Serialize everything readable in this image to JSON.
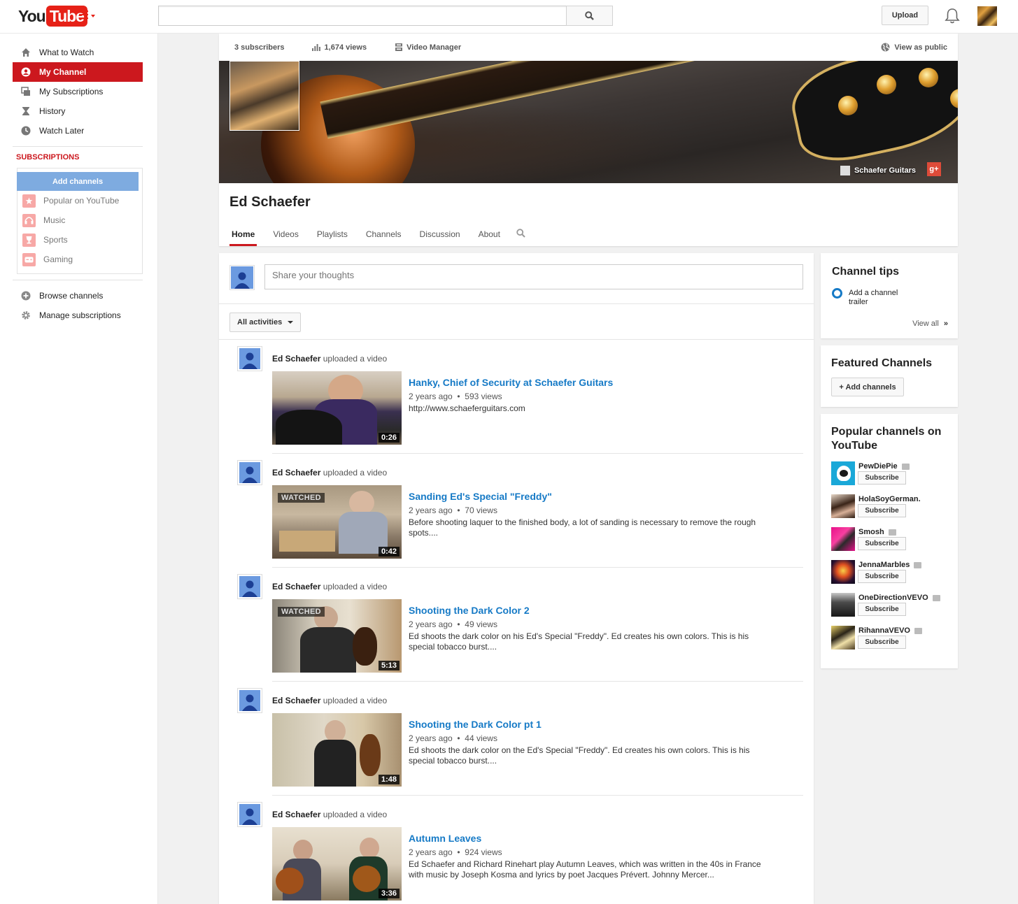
{
  "masthead": {
    "logo_you": "You",
    "logo_tube": "Tube",
    "search_placeholder": "",
    "upload_label": "Upload"
  },
  "guide": {
    "items": [
      {
        "label": "What to Watch",
        "icon": "home-icon"
      },
      {
        "label": "My Channel",
        "icon": "user-icon"
      },
      {
        "label": "My Subscriptions",
        "icon": "subscriptions-icon"
      },
      {
        "label": "History",
        "icon": "hourglass-icon"
      },
      {
        "label": "Watch Later",
        "icon": "clock-icon"
      }
    ],
    "subscriptions_heading": "SUBSCRIPTIONS",
    "add_channels_label": "Add channels",
    "subscriptions": [
      {
        "label": "Popular on YouTube",
        "icon": "star-icon"
      },
      {
        "label": "Music",
        "icon": "headphones-icon"
      },
      {
        "label": "Sports",
        "icon": "trophy-icon"
      },
      {
        "label": "Gaming",
        "icon": "gamepad-icon"
      }
    ],
    "browse_channels": "Browse channels",
    "manage_subscriptions": "Manage subscriptions"
  },
  "channel": {
    "subscribers": "3 subscribers",
    "views": "1,674 views",
    "video_manager": "Video Manager",
    "view_as_public": "View as public",
    "banner_link": "Schaefer Guitars",
    "gplus": "g+",
    "name": "Ed Schaefer",
    "tabs": [
      "Home",
      "Videos",
      "Playlists",
      "Channels",
      "Discussion",
      "About"
    ]
  },
  "feed": {
    "share_placeholder": "Share your thoughts",
    "filter_label": "All activities",
    "activities": [
      {
        "author": "Ed Schaefer",
        "action": "uploaded a video",
        "title": "Hanky, Chief of Security at Schaefer Guitars",
        "age": "2 years ago",
        "views": "593 views",
        "description": "http://www.schaeferguitars.com",
        "duration": "0:26",
        "watched": ""
      },
      {
        "author": "Ed Schaefer",
        "action": "uploaded a video",
        "title": "Sanding Ed's Special \"Freddy\"",
        "age": "2 years ago",
        "views": "70 views",
        "description": "Before shooting laquer to the finished body, a lot of sanding is necessary to remove the rough spots....",
        "duration": "0:42",
        "watched": "WATCHED"
      },
      {
        "author": "Ed Schaefer",
        "action": "uploaded a video",
        "title": "Shooting the Dark Color 2",
        "age": "2 years ago",
        "views": "49 views",
        "description": "Ed shoots the dark color on his Ed's Special \"Freddy\". Ed creates his own colors. This is his special tobacco burst....",
        "duration": "5:13",
        "watched": "WATCHED"
      },
      {
        "author": "Ed Schaefer",
        "action": "uploaded a video",
        "title": "Shooting the Dark Color pt 1",
        "age": "2 years ago",
        "views": "44 views",
        "description": "Ed shoots the dark color on the Ed's Special \"Freddy\". Ed creates his own colors. This is his special tobacco burst....",
        "duration": "1:48",
        "watched": ""
      },
      {
        "author": "Ed Schaefer",
        "action": "uploaded a video",
        "title": "Autumn Leaves",
        "age": "2 years ago",
        "views": "924 views",
        "description": "Ed Schaefer and Richard Rinehart play Autumn Leaves, which was written in the 40s in France with music by Joseph Kosma and lyrics by poet Jacques Prévert. Johnny Mercer...",
        "duration": "3:36",
        "watched": ""
      }
    ]
  },
  "sidebar": {
    "tips_title": "Channel tips",
    "tip_text": "Add a channel trailer",
    "view_all": "View all",
    "featured_title": "Featured Channels",
    "featured_add": "+ Add channels",
    "popular_title": "Popular channels on YouTube",
    "subscribe_label": "Subscribe",
    "popular": [
      {
        "name": "PewDiePie",
        "verified": true
      },
      {
        "name": "HolaSoyGerman.",
        "verified": false
      },
      {
        "name": "Smosh",
        "verified": true
      },
      {
        "name": "JennaMarbles",
        "verified": true
      },
      {
        "name": "OneDirectionVEVO",
        "verified": true
      },
      {
        "name": "RihannaVEVO",
        "verified": true
      }
    ]
  },
  "colors": {
    "brand_red": "#cc181e",
    "link_blue": "#167ac6",
    "add_channels_blue": "#7eabe0"
  }
}
